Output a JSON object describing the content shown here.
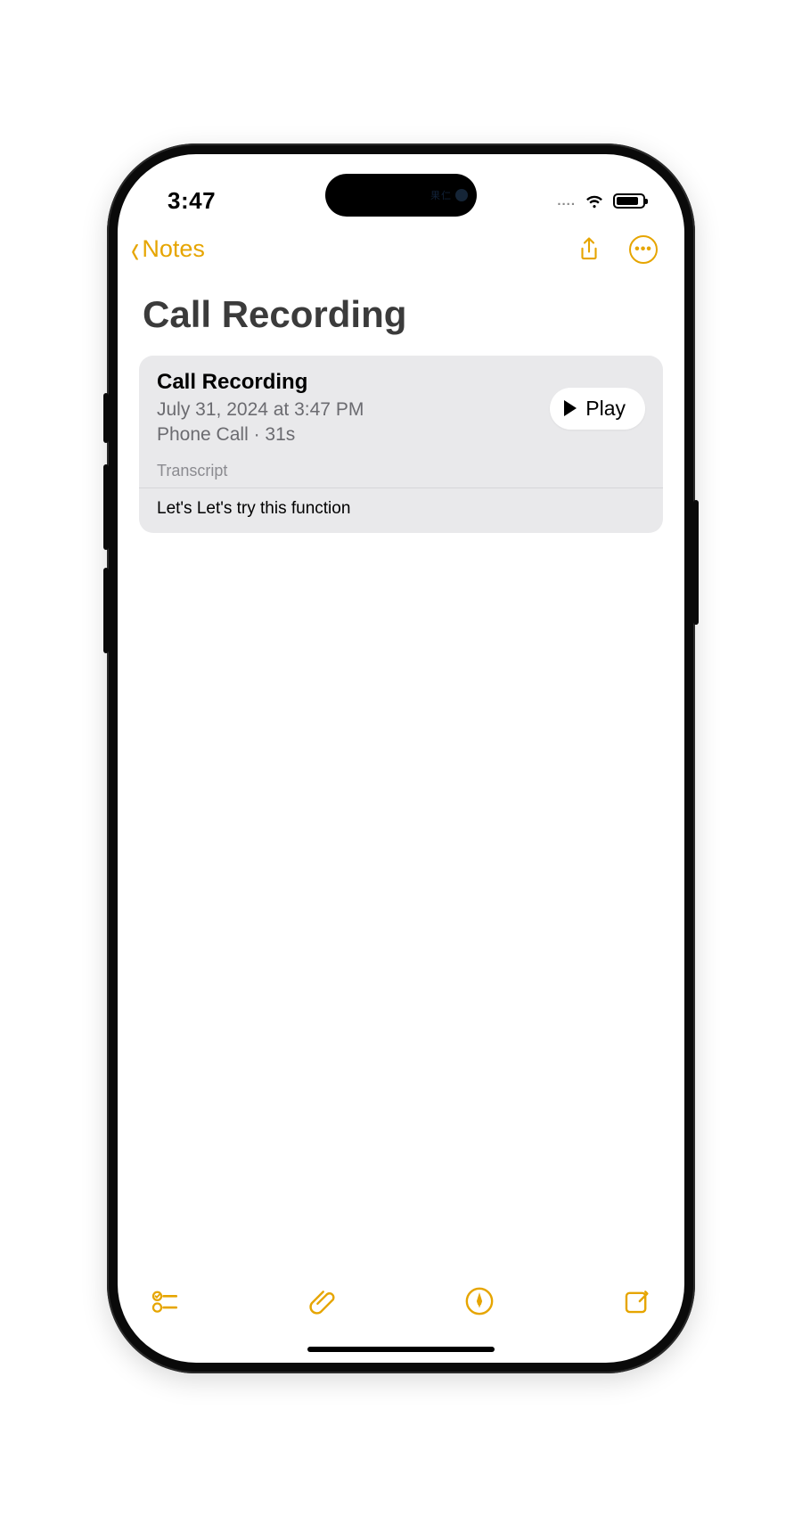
{
  "status": {
    "time": "3:47",
    "dots": "....",
    "island_text": "果仁"
  },
  "nav": {
    "back_label": "Notes"
  },
  "page": {
    "title": "Call Recording"
  },
  "recording": {
    "title": "Call Recording",
    "date_line": "July 31, 2024 at 3:47 PM",
    "meta_line": "Phone Call · 31s",
    "play_label": "Play",
    "transcript_label": "Transcript",
    "transcript_text": "Let's Let's try this function"
  },
  "colors": {
    "accent": "#E6A500",
    "card_bg": "#E9E9EB"
  }
}
